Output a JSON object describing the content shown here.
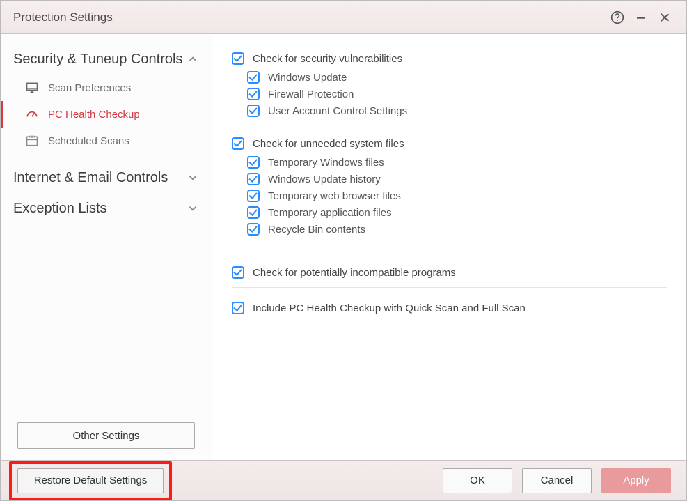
{
  "titlebar": {
    "title": "Protection Settings"
  },
  "sidebar": {
    "sections": [
      {
        "title": "Security & Tuneup Controls",
        "expanded": true,
        "items": [
          {
            "label": "Scan Preferences"
          },
          {
            "label": "PC Health Checkup"
          },
          {
            "label": "Scheduled Scans"
          }
        ]
      },
      {
        "title": "Internet & Email Controls",
        "expanded": false
      },
      {
        "title": "Exception Lists",
        "expanded": false
      }
    ],
    "other_settings_label": "Other Settings"
  },
  "main": {
    "group1": {
      "top": "Check for security vulnerabilities",
      "subs": [
        "Windows Update",
        "Firewall Protection",
        "User Account Control Settings"
      ]
    },
    "group2": {
      "top": "Check for unneeded system files",
      "subs": [
        "Temporary Windows files",
        "Windows Update history",
        "Temporary web browser files",
        "Temporary application files",
        "Recycle Bin contents"
      ]
    },
    "group3": {
      "top": "Check for potentially incompatible programs"
    },
    "group4": {
      "top": "Include PC Health Checkup with Quick Scan and Full Scan"
    }
  },
  "footer": {
    "restore": "Restore Default Settings",
    "ok": "OK",
    "cancel": "Cancel",
    "apply": "Apply"
  }
}
